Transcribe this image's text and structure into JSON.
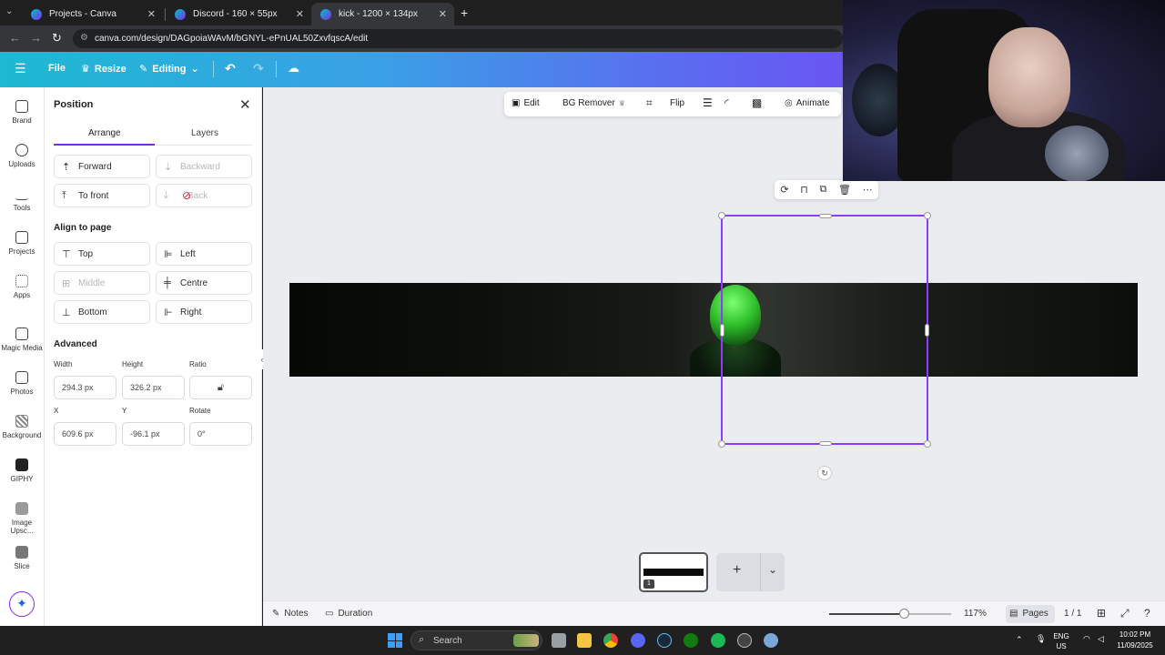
{
  "browser": {
    "tabs": [
      {
        "title": "Projects - Canva"
      },
      {
        "title": "Discord - 160 × 55px"
      },
      {
        "title": "kick - 1200 × 134px"
      }
    ],
    "new_tab_icon": "+",
    "url": "canva.com/design/DAGpoiaWAvM/bGNYL-ePnUAL50ZxvfqscA/edit"
  },
  "header": {
    "file_label": "File",
    "resize_label": "Resize",
    "editing_label": "Editing"
  },
  "rail": {
    "items": [
      {
        "label": "Brand",
        "icon": "brand-icon"
      },
      {
        "label": "Uploads",
        "icon": "upload-icon"
      },
      {
        "label": "Tools",
        "icon": "pencil-icon"
      },
      {
        "label": "Projects",
        "icon": "folder-icon"
      },
      {
        "label": "Apps",
        "icon": "apps-icon"
      },
      {
        "label": "Magic Media",
        "icon": "magic-media-icon"
      },
      {
        "label": "Photos",
        "icon": "photo-icon"
      },
      {
        "label": "Background",
        "icon": "background-icon"
      },
      {
        "label": "GIPHY",
        "icon": "giphy-icon"
      },
      {
        "label": "Image Upsc...",
        "icon": "image-upscale-icon"
      },
      {
        "label": "Slice",
        "icon": "slice-icon"
      }
    ]
  },
  "panel": {
    "title": "Position",
    "tabs": [
      "Arrange",
      "Layers"
    ],
    "arrange": {
      "forward": "Forward",
      "backward": "Backward",
      "to_front": "To front",
      "to_back": "Back"
    },
    "align_heading": "Align to page",
    "align": {
      "top": "Top",
      "left": "Left",
      "middle": "Middle",
      "centre": "Centre",
      "bottom": "Bottom",
      "right": "Right"
    },
    "advanced_heading": "Advanced",
    "labels": {
      "width": "Width",
      "height": "Height",
      "ratio": "Ratio",
      "x": "X",
      "y": "Y",
      "rotate": "Rotate"
    },
    "values": {
      "width": "294.3 px",
      "height": "326.2 px",
      "x": "609.6 px",
      "y": "-96.1 px",
      "rotate": "0°"
    }
  },
  "toolbar": {
    "edit": "Edit",
    "bg_remover": "BG Remover",
    "flip": "Flip",
    "animate": "Animate"
  },
  "footer": {
    "notes": "Notes",
    "duration": "Duration",
    "zoom": "117%",
    "zoom_level": 0.61,
    "pages": "Pages",
    "page_count": "1 / 1"
  },
  "page_thumb_number": "1",
  "taskbar": {
    "search_placeholder": "Search",
    "lang_line1": "ENG",
    "lang_line2": "US",
    "time": "10:02 PM",
    "date": "11/09/2025"
  },
  "colors": {
    "accent": "#8b3dff",
    "header_start": "#1db9d2",
    "header_end": "#6a55f2"
  }
}
